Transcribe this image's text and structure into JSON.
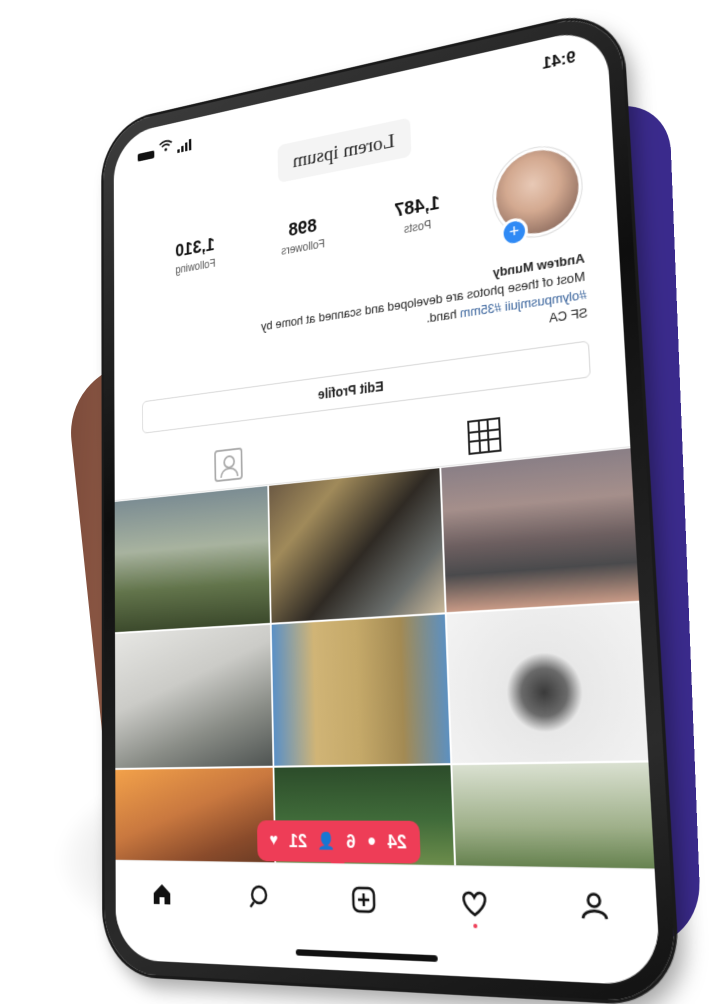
{
  "status_bar": {
    "time": "9:41"
  },
  "header": {
    "title": "Lorem ipsum"
  },
  "profile": {
    "stats": [
      {
        "number": "1,487",
        "label": "Posts"
      },
      {
        "number": "898",
        "label": "Followers"
      },
      {
        "number": "1,310",
        "label": "Following"
      }
    ],
    "add_badge": "+",
    "name": "Andrew Mundy",
    "bio_line1": "Most of these photos are developed and scanned at home by",
    "bio_line2": "hand.",
    "bio_tags": "#olympusmjuii #35mm",
    "bio_location": "SF CA",
    "edit_button": "Edit Profile"
  },
  "tabs": [
    "grid-icon",
    "tag-icon"
  ],
  "photos": [
    "photo-1",
    "photo-2",
    "photo-3",
    "photo-4",
    "photo-5",
    "photo-6",
    "photo-7",
    "photo-8",
    "photo-9"
  ],
  "notification": {
    "likes": "21",
    "followers": "6",
    "comments": "24"
  },
  "bottom_nav": [
    "home-icon",
    "search-icon",
    "add-icon",
    "heart-icon",
    "profile-icon"
  ],
  "colors": {
    "accent": "#ee3d57",
    "link": "#35609a",
    "badge": "#2f8af5"
  }
}
